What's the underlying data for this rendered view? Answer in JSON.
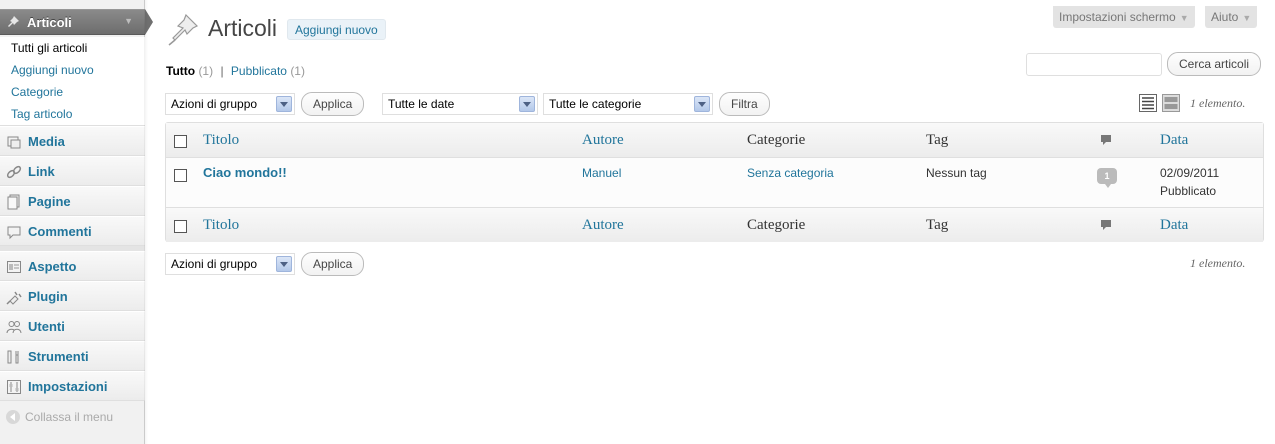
{
  "sidebar": {
    "active": {
      "label": "Articoli"
    },
    "submenu": [
      "Tutti gli articoli",
      "Aggiungi nuovo",
      "Categorie",
      "Tag articolo"
    ],
    "items": [
      {
        "label": "Media",
        "icon": "media-icon"
      },
      {
        "label": "Link",
        "icon": "link-icon"
      },
      {
        "label": "Pagine",
        "icon": "pages-icon"
      },
      {
        "label": "Commenti",
        "icon": "comments-icon"
      },
      {
        "label": "Aspetto",
        "icon": "appearance-icon"
      },
      {
        "label": "Plugin",
        "icon": "plugin-icon"
      },
      {
        "label": "Utenti",
        "icon": "users-icon"
      },
      {
        "label": "Strumenti",
        "icon": "tools-icon"
      },
      {
        "label": "Impostazioni",
        "icon": "settings-icon"
      }
    ],
    "collapse": "Collassa il menu"
  },
  "screen_meta": {
    "options": "Impostazioni schermo",
    "help": "Aiuto"
  },
  "header": {
    "title": "Articoli",
    "add_new": "Aggiungi nuovo"
  },
  "filters": {
    "all": "Tutto",
    "all_count": "(1)",
    "separator": "|",
    "published": "Pubblicato",
    "published_count": "(1)"
  },
  "search": {
    "button": "Cerca articoli",
    "value": ""
  },
  "bulk": {
    "select": "Azioni di gruppo",
    "apply": "Applica"
  },
  "dates": {
    "select": "Tutte le date"
  },
  "categories": {
    "select": "Tutte le categorie"
  },
  "filter_button": "Filtra",
  "count_text": "1 elemento.",
  "table": {
    "columns": {
      "title": "Titolo",
      "author": "Autore",
      "categories": "Categorie",
      "tags": "Tag",
      "date": "Data"
    },
    "rows": [
      {
        "title": "Ciao mondo!!",
        "author": "Manuel",
        "categories": "Senza categoria",
        "tags": "Nessun tag",
        "comments": "1",
        "date": "02/09/2011",
        "status": "Pubblicato"
      }
    ]
  },
  "colors": {
    "link": "#21759b",
    "active_menu": "#7a7a7a",
    "sidebar_bg": "#f1f1f1"
  }
}
